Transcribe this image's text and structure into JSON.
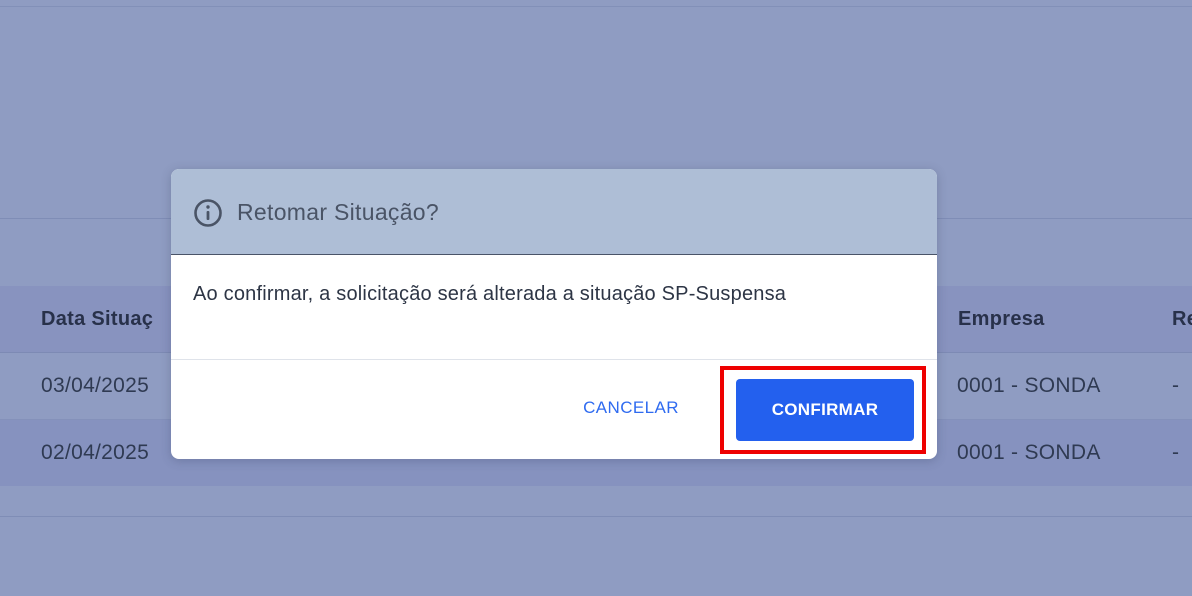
{
  "table": {
    "headers": {
      "data_situacao": "Data Situaç",
      "empresa": "Empresa",
      "re": "Re"
    },
    "rows": [
      {
        "data_situacao": "03/04/2025",
        "empresa": "0001 - SONDA",
        "re": "-"
      },
      {
        "data_situacao": "02/04/2025",
        "empresa": "0001 - SONDA",
        "re": "-"
      }
    ]
  },
  "dialog": {
    "icon": "info-circle-icon",
    "title": "Retomar Situação?",
    "message": "Ao confirmar, a solicitação será alterada a situação SP-Suspensa",
    "cancel_label": "CANCELAR",
    "confirm_label": "CONFIRMAR",
    "highlighted_element": "confirm_button",
    "highlight_color": "#ee0000"
  },
  "colors": {
    "overlay": "#8f9cc2",
    "header": "#aebed6",
    "primary": "#2360ee",
    "cancel_text": "#2f6bf0"
  }
}
